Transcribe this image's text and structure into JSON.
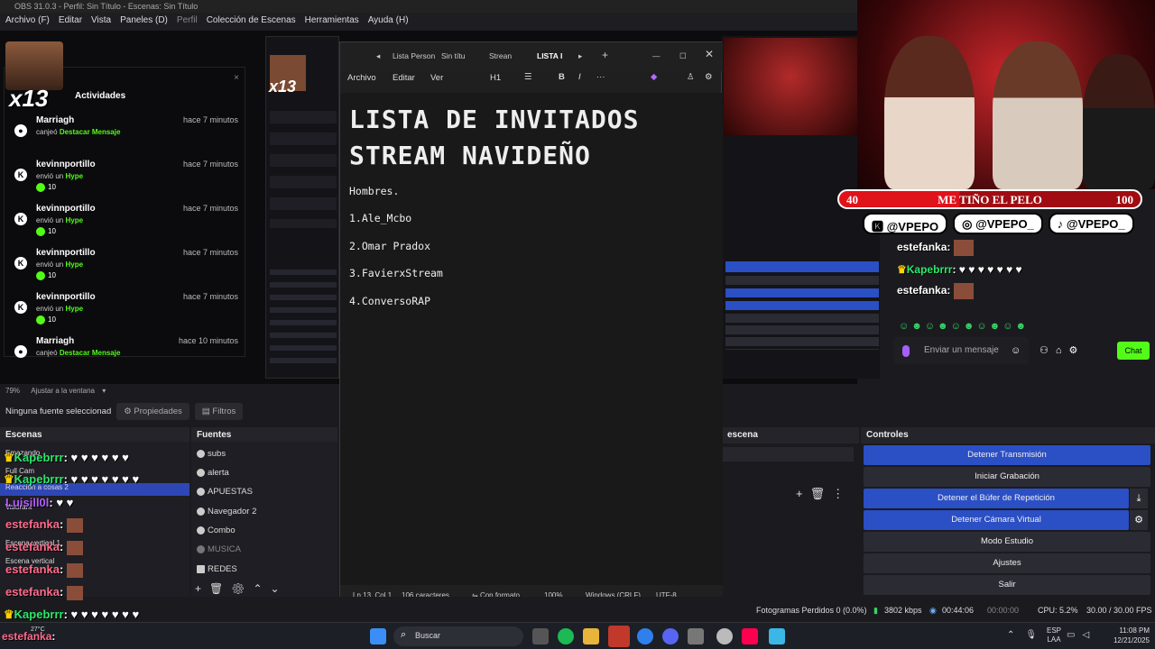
{
  "window": {
    "title": "OBS 31.0.3 - Perfil: Sin Título - Escenas: Sin Título"
  },
  "menu": [
    "Archivo (F)",
    "Editar",
    "Vista",
    "Paneles (D)",
    "Perfil",
    "Colección de Escenas",
    "Herramientas",
    "Ayuda (H)"
  ],
  "activity": {
    "header": "Actividades",
    "x13": "x13",
    "items": [
      {
        "icon": "kick",
        "user": "Marriagh",
        "time": "hace 7 minutos",
        "verb": "canjeó",
        "action": "Destacar Mensaje",
        "amount": ""
      },
      {
        "icon": "K",
        "user": "kevinnportillo",
        "time": "hace 7 minutos",
        "verb": "envió un",
        "action": "Hype",
        "amount": "10"
      },
      {
        "icon": "K",
        "user": "kevinnportillo",
        "time": "hace 7 minutos",
        "verb": "envió un",
        "action": "Hype",
        "amount": "10"
      },
      {
        "icon": "K",
        "user": "kevinnportillo",
        "time": "hace 7 minutos",
        "verb": "envió un",
        "action": "Hype",
        "amount": "10"
      },
      {
        "icon": "K",
        "user": "kevinnportillo",
        "time": "hace 7 minutos",
        "verb": "envió un",
        "action": "Hype",
        "amount": "10"
      },
      {
        "icon": "kick",
        "user": "Marriagh",
        "time": "hace 10 minutos",
        "verb": "canjeó",
        "action": "Destacar Mensaje",
        "amount": ""
      }
    ]
  },
  "stream_overlay": {
    "goal_left": "40",
    "goal_title": "ME TIÑO EL PELO",
    "goal_right": "100",
    "goal_progress": 0.4,
    "socials": [
      "@VPEPO",
      "@VPEPO_",
      "@VPEPO_"
    ],
    "chat": [
      {
        "user": "estefanka",
        "msg": ":"
      },
      {
        "user": "Kapebrrr",
        "msg": ": ♥ ♥ ♥ ♥ ♥ ♥ ♥"
      },
      {
        "user": "estefanka",
        "msg": ":"
      }
    ],
    "input_placeholder": "Enviar un mensaje",
    "chat_button": "Chat"
  },
  "editor": {
    "tabs": [
      "Lista Person",
      "Sin títu",
      "Strean",
      "LISTA I"
    ],
    "menu": [
      "Archivo",
      "Editar",
      "Ver"
    ],
    "heading_style": "H1",
    "title_line1": "LISTA DE INVITADOS",
    "title_line2": "STREAM NAVIDEÑO",
    "lines": [
      "Hombres.",
      "1.Ale_Mcbo",
      "2.Omar Pradox",
      "3.FavierxStream",
      "4.ConversoRAP"
    ],
    "status": {
      "pos": "Ln 13, Col 1",
      "chars": "106 caracteres.",
      "format": "Con formato",
      "zoom": "100%",
      "eol": "Windows (CRLF)",
      "enc": "UTF-8"
    }
  },
  "obs": {
    "zoom": "79%",
    "zoom_mode": "Ajustar a la ventana",
    "no_source": "Ninguna fuente seleccionad",
    "properties": "Propiedades",
    "filters": "Filtros",
    "scenes_header": "Escenas",
    "sources_header": "Fuentes",
    "scene_header_2": "escena",
    "controls_header": "Controles",
    "scenes": [
      "Emazando",
      "Full Cam",
      "Reacción a cosas 2",
      "Valorant",
      "Escena vertical 1",
      "Escena vertical"
    ],
    "sources": [
      "subs",
      "alerta",
      "APUESTAS",
      "Navegador 2",
      "Combo",
      "MUSICA",
      "REDES"
    ],
    "controls": {
      "stop_stream": "Detener Transmisión",
      "start_rec": "Iniciar Grabación",
      "stop_buffer": "Detener el Búfer de Repetición",
      "stop_vcam": "Detener Cámara Virtual",
      "studio": "Modo Estudio",
      "settings": "Ajustes",
      "exit": "Salir"
    },
    "status": {
      "dropped": "Fotogramas Perdidos 0 (0.0%)",
      "kbps": "3802 kbps",
      "stream_time": "00:44:06",
      "rec_time": "00:00:00",
      "cpu": "CPU: 5.2%",
      "fps": "30.00 / 30.00 FPS"
    }
  },
  "overlay_chat_left": [
    {
      "user": "Kapebrrr",
      "msg": ": ♥ ♥ ♥ ♥ ♥ ♥",
      "color": "#2ee86a"
    },
    {
      "user": "Kapebrrr",
      "msg": ": ♥ ♥ ♥ ♥ ♥ ♥ ♥",
      "color": "#2ee86a"
    },
    {
      "user": "Luisill0l",
      "msg": ": ♥ ♥",
      "color": "#b45cff"
    },
    {
      "user": "estefanka",
      "msg": ":",
      "color": "#ff6b8b"
    },
    {
      "user": "estefanka",
      "msg": ":",
      "color": "#ff6b8b"
    },
    {
      "user": "estefanka",
      "msg": ":",
      "color": "#ff6b8b"
    },
    {
      "user": "estefanka",
      "msg": ":",
      "color": "#ff6b8b"
    },
    {
      "user": "Kapebrrr",
      "msg": ": ♥ ♥ ♥ ♥ ♥ ♥ ♥",
      "color": "#2ee86a"
    },
    {
      "user": "estefanka",
      "msg": ":",
      "color": "#ff6b8b"
    }
  ],
  "taskbar": {
    "search": "Buscar",
    "weather": "27°C",
    "lang1": "ESP",
    "lang2": "LAA",
    "time": "11:08 PM",
    "date": "12/21/2025"
  },
  "colors": {
    "obs_blue": "#2b4fc4",
    "kick_green": "#53fc18",
    "goal_red": "#e0121a"
  }
}
